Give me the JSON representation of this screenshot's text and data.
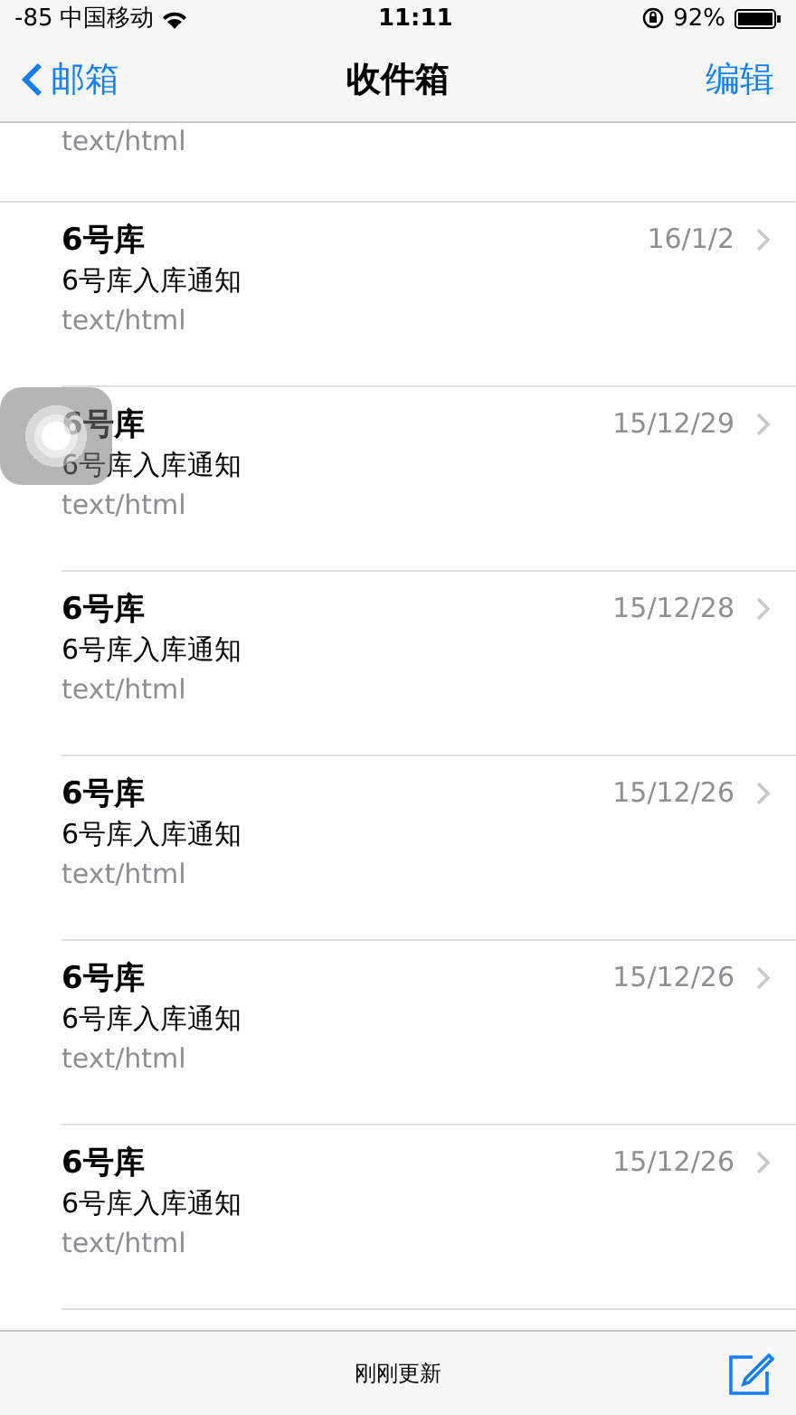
{
  "status_bar": {
    "signal": "-85",
    "carrier": "中国移动",
    "time": "11:11",
    "battery": "92%"
  },
  "nav": {
    "back": "邮箱",
    "title": "收件箱",
    "action": "编辑"
  },
  "partial_top": {
    "preview": "text/html"
  },
  "messages": [
    {
      "sender": "6号库",
      "date": "16/1/2",
      "subject": "6号库入库通知",
      "preview": "text/html"
    },
    {
      "sender": "6号库",
      "date": "15/12/29",
      "subject": "6号库入库通知",
      "preview": "text/html"
    },
    {
      "sender": "6号库",
      "date": "15/12/28",
      "subject": "6号库入库通知",
      "preview": "text/html"
    },
    {
      "sender": "6号库",
      "date": "15/12/26",
      "subject": "6号库入库通知",
      "preview": "text/html"
    },
    {
      "sender": "6号库",
      "date": "15/12/26",
      "subject": "6号库入库通知",
      "preview": "text/html"
    },
    {
      "sender": "6号库",
      "date": "15/12/26",
      "subject": "6号库入库通知",
      "preview": "text/html"
    }
  ],
  "toolbar": {
    "status": "刚刚更新"
  }
}
